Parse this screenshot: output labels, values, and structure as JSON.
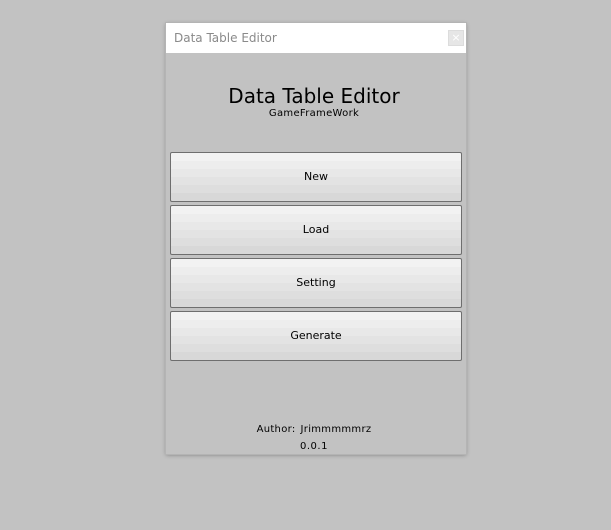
{
  "window": {
    "title": "Data Table Editor",
    "close_glyph": "×"
  },
  "header": {
    "title": "Data Table Editor",
    "subtitle": "GameFrameWork"
  },
  "buttons": {
    "new_label": "New",
    "load_label": "Load",
    "setting_label": "Setting",
    "generate_label": "Generate"
  },
  "footer": {
    "author_label": "Author:",
    "author_name": "Jrimmmmmrz",
    "version": "0.0.1"
  },
  "colors": {
    "background": "#c2c2c2",
    "titlebar": "#ffffff",
    "button_border": "#6e6e6e"
  }
}
